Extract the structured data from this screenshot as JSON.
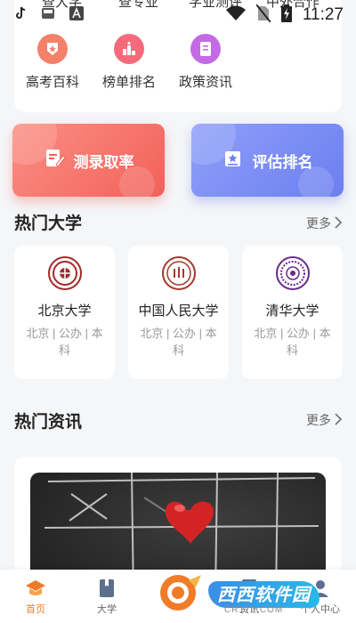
{
  "status_bar": {
    "time": "11:27",
    "left_icons": [
      "tiktok-icon",
      "tray-icon",
      "a-font-icon"
    ],
    "right_icons": [
      "wifi-icon",
      "no-sim-icon",
      "battery-charging-icon"
    ]
  },
  "top_row_cut": [
    "查大学",
    "查专业",
    "学业测评",
    "中外合作"
  ],
  "categories": [
    {
      "label": "高考百科",
      "icon": "badge-icon",
      "color": "#f4816a"
    },
    {
      "label": "榜单排名",
      "icon": "podium-icon",
      "color": "#f46a7a"
    },
    {
      "label": "政策资讯",
      "icon": "document-icon",
      "color": "#c46ae6"
    }
  ],
  "actions": [
    {
      "label": "测录取率",
      "icon": "edit-icon",
      "color": "#f2615a"
    },
    {
      "label": "评估排名",
      "icon": "ranking-star-icon",
      "color": "#6c7ff0"
    }
  ],
  "hot_universities": {
    "title": "热门大学",
    "more": "更多",
    "items": [
      {
        "name": "北京大学",
        "meta": "北京 | 公办 | 本科",
        "logo_color": "#a12b2b"
      },
      {
        "name": "中国人民大学",
        "meta": "北京 | 公办 | 本科",
        "logo_color": "#a23a2e"
      },
      {
        "name": "清华大学",
        "meta": "北京 | 公办 | 本科",
        "logo_color": "#6a2a8c"
      }
    ]
  },
  "hot_news": {
    "title": "热门资讯",
    "more": "更多"
  },
  "bottom_nav": [
    {
      "label": "首页",
      "icon": "graduation-cap-icon",
      "active": true
    },
    {
      "label": "大学",
      "icon": "book-icon",
      "active": false
    },
    {
      "label": "",
      "icon": "center-fab-icon",
      "active": false
    },
    {
      "label": "资讯",
      "icon": "news-icon",
      "active": false
    },
    {
      "label": "个人中心",
      "icon": "user-icon",
      "active": false
    }
  ],
  "watermark": {
    "text": "西西软件园",
    "sub": "CR173.COM"
  },
  "colors": {
    "accent": "#f07c2a",
    "background": "#f5f6f8"
  }
}
